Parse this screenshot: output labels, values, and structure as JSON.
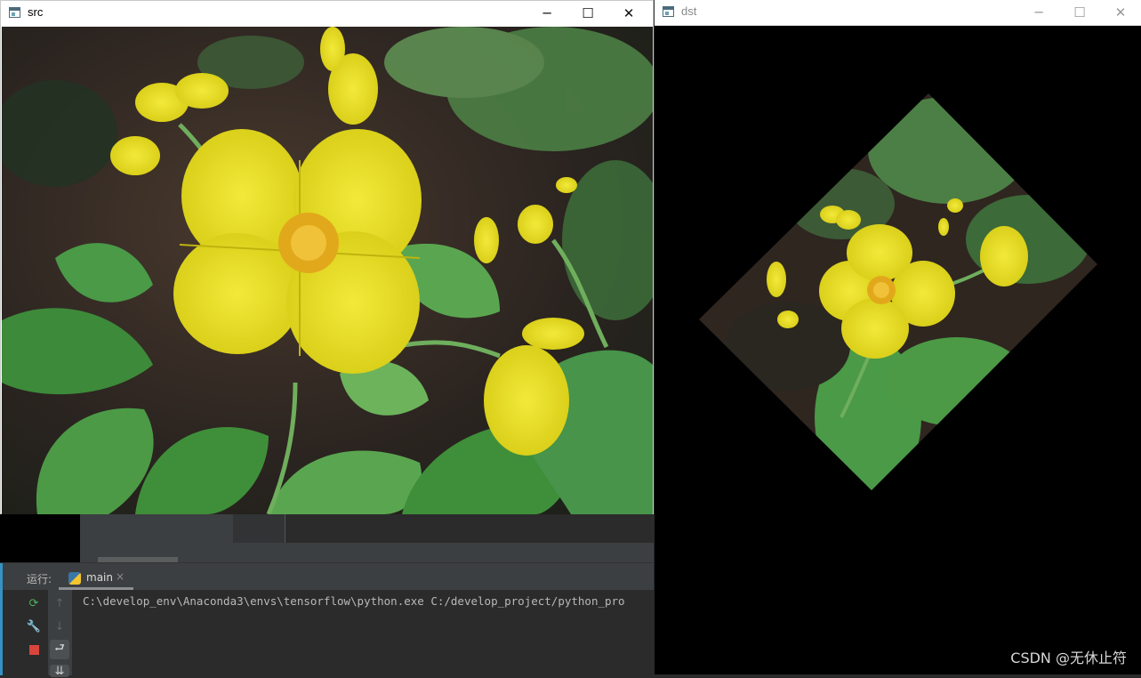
{
  "src_window": {
    "title": "src",
    "controls": {
      "minimize": "─",
      "maximize": "☐",
      "close": "✕"
    }
  },
  "dst_window": {
    "title": "dst",
    "controls": {
      "minimize": "─",
      "maximize": "☐",
      "close": "✕"
    },
    "watermark": "CSDN @无休止符"
  },
  "run_panel": {
    "label": "运行:",
    "tab_label": "main",
    "tab_close": "×",
    "console_line": "C:\\develop_env\\Anaconda3\\envs\\tensorflow\\python.exe C:/develop_project/python_pro"
  },
  "tools": {
    "rerun": "⟳",
    "wrench": "🔧",
    "up": "↑",
    "down": "↓",
    "softwrap": "⮐",
    "scrollend": "⇊"
  },
  "colors": {
    "petal": "#e6dc1e",
    "petal_shade": "#c9bd10",
    "stamen": "#e2a81c",
    "leaf": "#3f8f3a",
    "leaf_light": "#6cb35c",
    "soil": "#3a2a22",
    "accent": "#3592c4"
  }
}
